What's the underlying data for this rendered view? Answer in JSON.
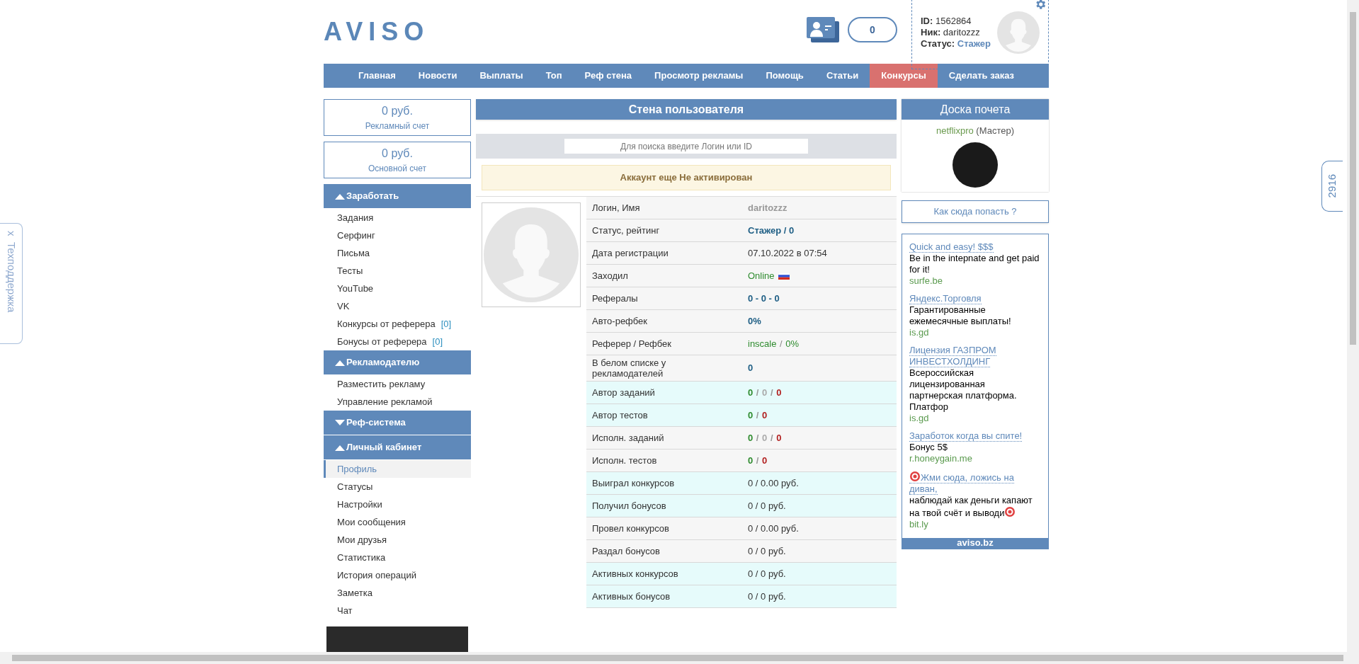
{
  "logo": "AVISO",
  "header": {
    "counter": "0",
    "profile": {
      "id_label": "ID:",
      "id": "1562864",
      "nick_label": "Ник:",
      "nick": "daritozzz",
      "status_label": "Статус:",
      "status": "Стажер"
    }
  },
  "nav": [
    {
      "label": "Главная",
      "selected": false
    },
    {
      "label": "Новости",
      "selected": false
    },
    {
      "label": "Выплаты",
      "selected": false
    },
    {
      "label": "Топ",
      "selected": false
    },
    {
      "label": "Реф стена",
      "selected": false
    },
    {
      "label": "Просмотр рекламы",
      "selected": false
    },
    {
      "label": "Помощь",
      "selected": false
    },
    {
      "label": "Статьи",
      "selected": false
    },
    {
      "label": "Конкурсы",
      "selected": true
    },
    {
      "label": "Сделать заказ",
      "selected": false
    }
  ],
  "balances": [
    {
      "amount": "0 руб.",
      "label": "Рекламный счет"
    },
    {
      "amount": "0 руб.",
      "label": "Основной счет"
    }
  ],
  "sidebar": [
    {
      "title": "Заработать",
      "expanded": true,
      "items": [
        {
          "label": "Задания",
          "selected": false
        },
        {
          "label": "Серфинг",
          "selected": false
        },
        {
          "label": "Письма",
          "selected": false
        },
        {
          "label": "Тесты",
          "selected": false
        },
        {
          "label": "YouTube",
          "selected": false
        },
        {
          "label": "VK",
          "selected": false
        },
        {
          "label": "Конкурсы от реферера",
          "count": "[0]",
          "selected": false
        },
        {
          "label": "Бонусы от реферера",
          "count": "[0]",
          "selected": false
        }
      ]
    },
    {
      "title": "Рекламодателю",
      "expanded": true,
      "items": [
        {
          "label": "Разместить рекламу",
          "selected": false
        },
        {
          "label": "Управление рекламой",
          "selected": false
        }
      ]
    },
    {
      "title": "Реф-система",
      "expanded": false
    },
    {
      "title": "Личный кабинет",
      "expanded": true,
      "items": [
        {
          "label": "Профиль",
          "selected": true
        },
        {
          "label": "Статусы",
          "selected": false
        },
        {
          "label": "Настройки",
          "selected": false
        },
        {
          "label": "Мои сообщения",
          "selected": false
        },
        {
          "label": "Мои друзья",
          "selected": false
        },
        {
          "label": "Статистика",
          "selected": false
        },
        {
          "label": "История операций",
          "selected": false
        },
        {
          "label": "Заметка",
          "selected": false
        },
        {
          "label": "Чат",
          "selected": false
        }
      ]
    }
  ],
  "wall": {
    "title": "Стена пользователя",
    "search": {
      "placeholder": "Для поиска введите Логин или ID"
    },
    "alert": "Аккаунт еще Не активирован",
    "rows": [
      {
        "label": "Логин, Имя",
        "highlight": false,
        "bold": true,
        "parts": [
          {
            "text": "daritozzz",
            "color": "#999999"
          }
        ]
      },
      {
        "label": "Статус, рейтинг",
        "highlight": false,
        "bold": true,
        "parts": [
          {
            "text": "Стажер / 0",
            "color": "#1f5f85"
          }
        ]
      },
      {
        "label": "Дата регистрации",
        "highlight": false,
        "bold": false,
        "parts": [
          {
            "text": "07.10.2022 в 07:54",
            "color": "#333333"
          }
        ]
      },
      {
        "label": "Заходил",
        "highlight": false,
        "bold": false,
        "flag": true,
        "parts": [
          {
            "text": "Online",
            "color": "#2e8b2e"
          }
        ]
      },
      {
        "label": "Рефералы",
        "highlight": false,
        "bold": true,
        "parts": [
          {
            "text": "0 - 0 - 0",
            "color": "#1f5f85"
          }
        ]
      },
      {
        "label": "Авто-рефбек",
        "highlight": false,
        "bold": true,
        "parts": [
          {
            "text": "0%",
            "color": "#1f5f85"
          }
        ]
      },
      {
        "label": "Реферер / Рефбек",
        "highlight": false,
        "bold": false,
        "parts": [
          {
            "text": "inscale",
            "color": "#2e8b2e"
          },
          {
            "text": " / "
          },
          {
            "text": "0%",
            "color": "#2e8b2e"
          }
        ]
      },
      {
        "label": "В белом списке у рекламодателей",
        "highlight": false,
        "bold": true,
        "parts": [
          {
            "text": "0",
            "color": "#1f5f85"
          }
        ]
      },
      {
        "label": "Автор заданий",
        "highlight": true,
        "bold": true,
        "parts": [
          {
            "text": "0",
            "color": "#2e8b2e"
          },
          {
            "text": " / ",
            "color": "#999999"
          },
          {
            "text": "0",
            "color": "#aaaaaa"
          },
          {
            "text": " / ",
            "color": "#999999"
          },
          {
            "text": "0",
            "color": "#b22222"
          }
        ]
      },
      {
        "label": "Автор тестов",
        "highlight": true,
        "bold": true,
        "parts": [
          {
            "text": "0",
            "color": "#2e8b2e"
          },
          {
            "text": " / ",
            "color": "#999999"
          },
          {
            "text": "0",
            "color": "#b22222"
          }
        ]
      },
      {
        "label": "Исполн. заданий",
        "highlight": false,
        "bold": true,
        "parts": [
          {
            "text": "0",
            "color": "#2e8b2e"
          },
          {
            "text": " / ",
            "color": "#999999"
          },
          {
            "text": "0",
            "color": "#aaaaaa"
          },
          {
            "text": " / ",
            "color": "#999999"
          },
          {
            "text": "0",
            "color": "#b22222"
          }
        ]
      },
      {
        "label": "Исполн. тестов",
        "highlight": false,
        "bold": true,
        "parts": [
          {
            "text": "0",
            "color": "#2e8b2e"
          },
          {
            "text": " / ",
            "color": "#999999"
          },
          {
            "text": "0",
            "color": "#b22222"
          }
        ]
      },
      {
        "label": "Выиграл конкурсов",
        "highlight": true,
        "bold": false,
        "parts": [
          {
            "text": "0 / 0.00 руб.",
            "color": "#333333"
          }
        ]
      },
      {
        "label": "Получил бонусов",
        "highlight": true,
        "bold": false,
        "parts": [
          {
            "text": "0 / 0 руб.",
            "color": "#333333"
          }
        ]
      },
      {
        "label": "Провел конкурсов",
        "highlight": false,
        "bold": false,
        "parts": [
          {
            "text": "0 / 0.00 руб.",
            "color": "#333333"
          }
        ]
      },
      {
        "label": "Раздал бонусов",
        "highlight": false,
        "bold": false,
        "parts": [
          {
            "text": "0 / 0 руб.",
            "color": "#333333"
          }
        ]
      },
      {
        "label": "Активных конкурсов",
        "highlight": true,
        "bold": false,
        "parts": [
          {
            "text": "0 / 0 руб.",
            "color": "#333333"
          }
        ]
      },
      {
        "label": "Активных бонусов",
        "highlight": true,
        "bold": false,
        "parts": [
          {
            "text": "0 / 0 руб.",
            "color": "#333333"
          }
        ]
      }
    ]
  },
  "honor": {
    "title": "Доска почета",
    "user": "netflixpro",
    "rank": "(Мастер)",
    "button": "Как сюда попасть ?"
  },
  "ads": {
    "items": [
      {
        "title": "Quick and easy! $$$",
        "text": "Be in the intepnate and get paid for it!",
        "domain": "surfe.be",
        "emoji": false
      },
      {
        "title": "Яндекс.Торговля",
        "text": "Гарантированные ежемесячные выплаты!",
        "domain": "is.gd",
        "emoji": false
      },
      {
        "title": "Лицензия ГАЗПРОМ ИНВЕСТХОЛДИНГ",
        "text": "Всероссийская лицензированная партнерская платформа. Платфор",
        "domain": "is.gd",
        "emoji": false
      },
      {
        "title": "Заработок когда вы спите!",
        "text": "Бонус 5$",
        "domain": "r.honeygain.me",
        "emoji": false
      },
      {
        "title": "Жми сюда, ложись на диван,",
        "text": "наблюдай как деньги капают на твой счёт и выводи",
        "domain": "bit.ly",
        "emoji": true
      }
    ],
    "footer": "aviso.bz"
  },
  "support_tab": {
    "close": "x",
    "label": "Техподдержка"
  },
  "side_counter": "2916"
}
